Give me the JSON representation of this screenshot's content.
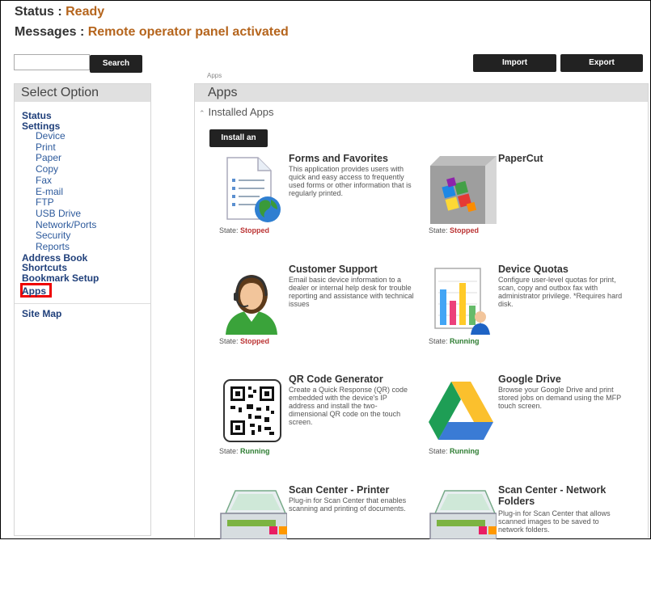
{
  "status": {
    "label": "Status :",
    "value": "Ready"
  },
  "messages": {
    "label": "Messages :",
    "value": "Remote operator panel activated"
  },
  "search": {
    "button_label": "Search",
    "value": "",
    "placeholder": ""
  },
  "toolbar": {
    "import_label": "Import Configuration",
    "export_label": "Export Configuration"
  },
  "breadcrumb": "Apps",
  "sidebar": {
    "heading": "Select Option",
    "items": [
      {
        "label": "Status",
        "level": "top"
      },
      {
        "label": "Settings",
        "level": "top"
      },
      {
        "label": "Device",
        "level": "sub"
      },
      {
        "label": "Print",
        "level": "sub"
      },
      {
        "label": "Paper",
        "level": "sub"
      },
      {
        "label": "Copy",
        "level": "sub"
      },
      {
        "label": "Fax",
        "level": "sub"
      },
      {
        "label": "E-mail",
        "level": "sub"
      },
      {
        "label": "FTP",
        "level": "sub"
      },
      {
        "label": "USB Drive",
        "level": "sub"
      },
      {
        "label": "Network/Ports",
        "level": "sub"
      },
      {
        "label": "Security",
        "level": "sub"
      },
      {
        "label": "Reports",
        "level": "sub"
      },
      {
        "label": "Address Book",
        "level": "top"
      },
      {
        "label": "Shortcuts",
        "level": "top"
      },
      {
        "label": "Bookmark Setup",
        "level": "top"
      }
    ],
    "apps_label": "Apps",
    "sitemap_label": "Site Map"
  },
  "main": {
    "heading": "Apps",
    "installed_label": "Installed Apps",
    "install_button": "Install an app",
    "state_label": "State:",
    "apps": [
      {
        "title": "Forms and Favorites",
        "desc": "This application provides users with quick and easy access to frequently used forms or other information that is regularly printed.",
        "state": "Stopped",
        "icon": "forms-favorites-icon"
      },
      {
        "title": "PaperCut",
        "desc": "",
        "state": "Stopped",
        "icon": "papercut-icon"
      },
      {
        "title": "Customer Support",
        "desc": "Email basic device information to a dealer or internal help desk for trouble reporting and assistance with technical issues",
        "state": "Stopped",
        "icon": "customer-support-icon"
      },
      {
        "title": "Device Quotas",
        "desc": "Configure user-level quotas for print, scan, copy and outbox fax with administrator privilege. *Requires hard disk.",
        "state": "Running",
        "icon": "device-quotas-icon"
      },
      {
        "title": "QR Code Generator",
        "desc": "Create a Quick Response (QR) code embedded with the device's IP address and install the two-dimensional QR code on the touch screen.",
        "state": "Running",
        "icon": "qr-code-icon"
      },
      {
        "title": "Google Drive",
        "desc": "Browse your Google Drive and print stored jobs on demand using the MFP touch screen.",
        "state": "Running",
        "icon": "google-drive-icon"
      },
      {
        "title": "Scan Center - Printer",
        "desc": "Plug-in for Scan Center that enables scanning and printing of documents.",
        "state": "",
        "icon": "scanner-icon"
      },
      {
        "title": "Scan Center - Network Folders",
        "desc": "Plug-in for Scan Center that allows scanned images to be saved to network folders.",
        "state": "",
        "icon": "scanner-icon"
      }
    ]
  },
  "colors": {
    "accent": "#b5651d",
    "nav_link": "#1f3f7a",
    "running": "#2e7d32",
    "stopped": "#b33333",
    "highlight": "#e00000"
  }
}
